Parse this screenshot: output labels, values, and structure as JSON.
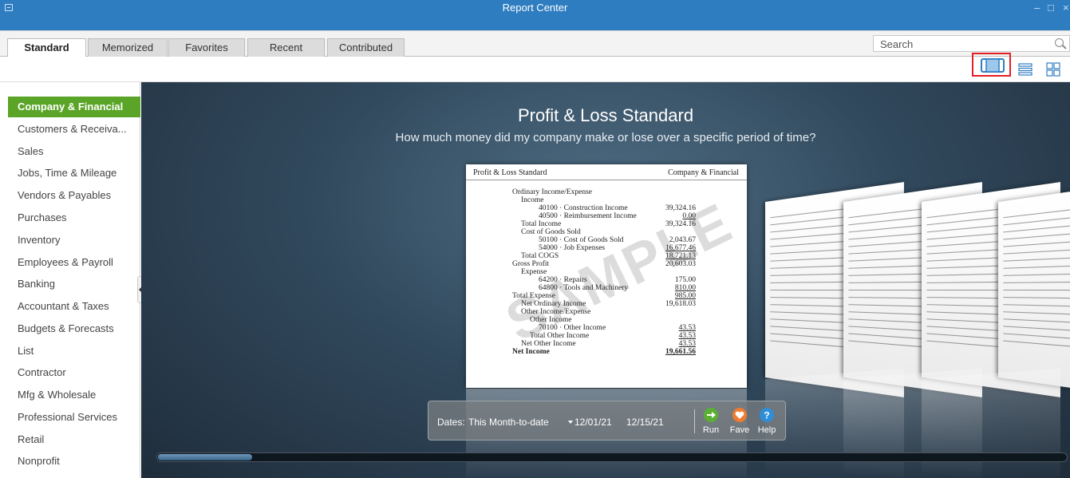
{
  "window": {
    "title": "Report Center",
    "controls": [
      "minimize-icon",
      "maximize-icon",
      "close-icon"
    ]
  },
  "tabs": [
    {
      "label": "Standard",
      "active": true
    },
    {
      "label": "Memorized",
      "active": false
    },
    {
      "label": "Favorites",
      "active": false
    },
    {
      "label": "Recent",
      "active": false
    },
    {
      "label": "Contributed",
      "active": false
    }
  ],
  "search": {
    "placeholder": "Search",
    "icon": "search-icon"
  },
  "view_modes": [
    {
      "name": "carousel-view-icon",
      "selected": true
    },
    {
      "name": "list-view-icon",
      "selected": false
    },
    {
      "name": "grid-view-icon",
      "selected": false
    }
  ],
  "sidebar": {
    "items": [
      {
        "label": "Company & Financial",
        "active": true
      },
      {
        "label": "Customers & Receiva...",
        "active": false
      },
      {
        "label": "Sales",
        "active": false
      },
      {
        "label": "Jobs, Time & Mileage",
        "active": false
      },
      {
        "label": "Vendors & Payables",
        "active": false
      },
      {
        "label": "Purchases",
        "active": false
      },
      {
        "label": "Inventory",
        "active": false
      },
      {
        "label": "Employees & Payroll",
        "active": false
      },
      {
        "label": "Banking",
        "active": false
      },
      {
        "label": "Accountant & Taxes",
        "active": false
      },
      {
        "label": "Budgets & Forecasts",
        "active": false
      },
      {
        "label": "List",
        "active": false
      },
      {
        "label": "Contractor",
        "active": false
      },
      {
        "label": "Mfg & Wholesale",
        "active": false
      },
      {
        "label": "Professional Services",
        "active": false
      },
      {
        "label": "Retail",
        "active": false
      },
      {
        "label": "Nonprofit",
        "active": false
      }
    ]
  },
  "report": {
    "title": "Profit & Loss Standard",
    "description": "How much money did my company make or lose over a specific period of time?",
    "sample": {
      "header_title": "Profit & Loss Standard",
      "header_category": "Company & Financial",
      "watermark": "SAMPLE",
      "rows": [
        {
          "label": "Ordinary Income/Expense",
          "value": "",
          "indent": 0,
          "bold": false,
          "underline": false
        },
        {
          "label": "Income",
          "value": "",
          "indent": 1,
          "bold": false,
          "underline": false
        },
        {
          "label": "40100 · Construction Income",
          "value": "39,324.16",
          "indent": 3,
          "bold": false,
          "underline": false
        },
        {
          "label": "40500 · Reimbursement Income",
          "value": "0.00",
          "indent": 3,
          "bold": false,
          "underline": true
        },
        {
          "label": "Total Income",
          "value": "39,324.16",
          "indent": 1,
          "bold": false,
          "underline": false
        },
        {
          "label": "Cost of Goods Sold",
          "value": "",
          "indent": 1,
          "bold": false,
          "underline": false
        },
        {
          "label": "50100 · Cost of Goods Sold",
          "value": "2,043.67",
          "indent": 3,
          "bold": false,
          "underline": false
        },
        {
          "label": "54000 · Job Expenses",
          "value": "16,677.46",
          "indent": 3,
          "bold": false,
          "underline": true
        },
        {
          "label": "Total COGS",
          "value": "18,721.13",
          "indent": 1,
          "bold": false,
          "underline": true
        },
        {
          "label": "Gross Profit",
          "value": "20,603.03",
          "indent": 0,
          "bold": false,
          "underline": false
        },
        {
          "label": "Expense",
          "value": "",
          "indent": 1,
          "bold": false,
          "underline": false
        },
        {
          "label": "64200 · Repairs",
          "value": "175.00",
          "indent": 3,
          "bold": false,
          "underline": false
        },
        {
          "label": "64800 · Tools and Machinery",
          "value": "810.00",
          "indent": 3,
          "bold": false,
          "underline": true
        },
        {
          "label": "Total Expense",
          "value": "985.00",
          "indent": 0,
          "bold": false,
          "underline": true
        },
        {
          "label": "Net Ordinary Income",
          "value": "19,618.03",
          "indent": 1,
          "bold": false,
          "underline": false
        },
        {
          "label": "Other Income/Expense",
          "value": "",
          "indent": 1,
          "bold": false,
          "underline": false
        },
        {
          "label": "Other Income",
          "value": "",
          "indent": 2,
          "bold": false,
          "underline": false
        },
        {
          "label": "70100 · Other Income",
          "value": "43.53",
          "indent": 3,
          "bold": false,
          "underline": true
        },
        {
          "label": "Total Other Income",
          "value": "43.53",
          "indent": 2,
          "bold": false,
          "underline": true
        },
        {
          "label": "Net Other Income",
          "value": "43.53",
          "indent": 1,
          "bold": false,
          "underline": true
        },
        {
          "label": "Net Income",
          "value": "19,661.56",
          "indent": 0,
          "bold": true,
          "underline": true
        }
      ]
    }
  },
  "dates": {
    "label": "Dates:",
    "range": "This Month-to-date",
    "from": "12/01/21",
    "to": "12/15/21"
  },
  "actions": [
    {
      "name": "run",
      "label": "Run",
      "icon": "run-icon",
      "color": "#5ab031"
    },
    {
      "name": "fave",
      "label": "Fave",
      "icon": "heart-icon",
      "color": "#f07b2f"
    },
    {
      "name": "help",
      "label": "Help",
      "icon": "help-icon",
      "color": "#2f8ed8"
    }
  ],
  "colors": {
    "titlebar": "#2e7dc1",
    "active_category": "#5aa427",
    "selected_view_outline": "#e31f26"
  }
}
